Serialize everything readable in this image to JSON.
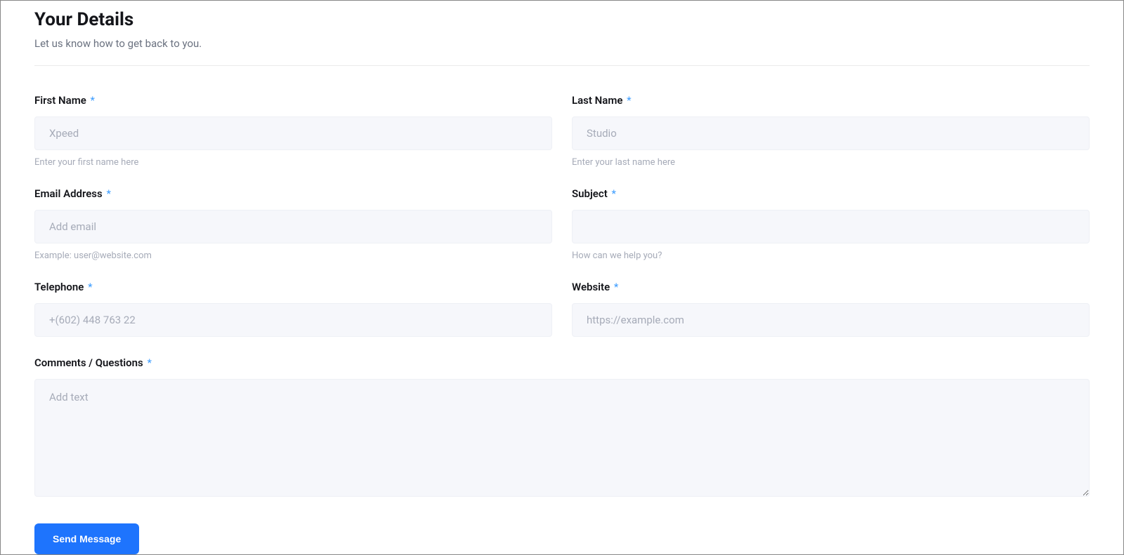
{
  "header": {
    "title": "Your Details",
    "subtitle": "Let us know how to get back to you."
  },
  "fields": {
    "first_name": {
      "label": "First Name",
      "placeholder": "Xpeed",
      "help": "Enter your first name here"
    },
    "last_name": {
      "label": "Last Name",
      "placeholder": "Studio",
      "help": "Enter your last name here"
    },
    "email": {
      "label": "Email Address",
      "placeholder": "Add email",
      "help": "Example: user@website.com"
    },
    "subject": {
      "label": "Subject",
      "placeholder": "",
      "help": "How can we help you?"
    },
    "telephone": {
      "label": "Telephone",
      "placeholder": "+(602) 448 763 22"
    },
    "website": {
      "label": "Website",
      "placeholder": "https://example.com"
    },
    "comments": {
      "label": "Comments / Questions",
      "placeholder": "Add text"
    }
  },
  "required_mark": "*",
  "submit_label": "Send Message"
}
